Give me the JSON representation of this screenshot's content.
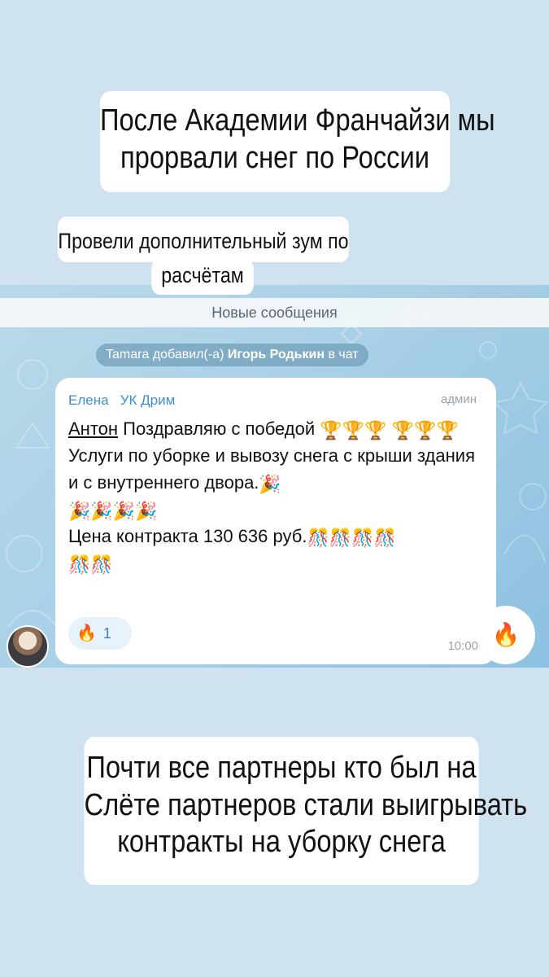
{
  "captions": {
    "top": [
      "После Академии Франчайзи мы",
      "прорвали снег по России"
    ],
    "middle": [
      "Провели дополнительный зум по",
      "расчётам"
    ],
    "bottom": [
      "Почти все партнеры кто был на",
      "Слёте партнеров стали выигрывать",
      "контракты на уборку снега"
    ]
  },
  "chat": {
    "new_messages_label": "Новые сообщения",
    "service_message": {
      "actor": "Tamara",
      "action": "добавил(-а)",
      "target": "Игорь Родькин",
      "suffix": "в чат"
    },
    "message": {
      "sender": "Елена",
      "company": "УК Дрим",
      "role": "админ",
      "mention": "Антон",
      "line1": "Поздравляю с победой",
      "line2": "Услуги по уборке и вывозу снега с крыши здания и с внутреннего двора.",
      "line3": "Цена контракта 130 636 руб.",
      "time": "10:00",
      "reaction": {
        "icon": "fire-icon",
        "count": "1"
      }
    }
  },
  "icons": {
    "trophy": "trophy-icon",
    "party": "party-popper-icon",
    "confetti": "confetti-ball-icon",
    "fire": "fire-icon"
  },
  "colors": {
    "page_background": "#cfe2ef",
    "chat_background": "#a6cfe6",
    "sender_name": "#3f8ed0",
    "caption_background": "#ffffff"
  }
}
